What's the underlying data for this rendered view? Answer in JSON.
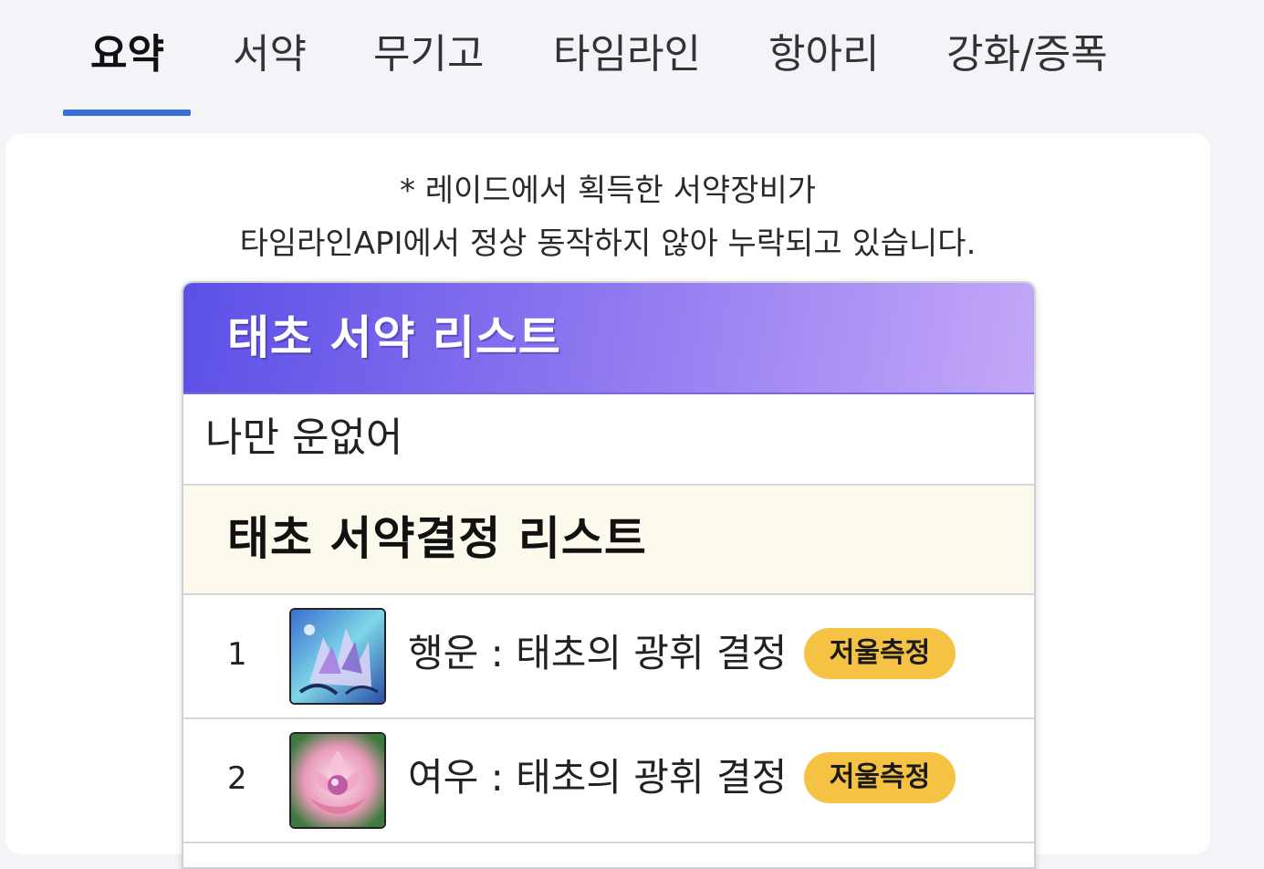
{
  "tabs": [
    {
      "label": "요약",
      "active": true
    },
    {
      "label": "서약",
      "active": false
    },
    {
      "label": "무기고",
      "active": false
    },
    {
      "label": "타임라인",
      "active": false
    },
    {
      "label": "항아리",
      "active": false
    },
    {
      "label": "강화/증폭",
      "active": false
    }
  ],
  "notice": {
    "line1": "* 레이드에서 획득한 서약장비가",
    "line2": "타임라인API에서 정상 동작하지 않아 누락되고 있습니다."
  },
  "pledge_list": {
    "title": "태초 서약 리스트",
    "empty_text": "나만 운없어"
  },
  "crystal_list": {
    "title": "태초 서약결정 리스트",
    "items": [
      {
        "rank": "1",
        "name": "행운 : 태초의 광휘 결정",
        "badge": "저울측정",
        "icon": "luck-crystal-icon"
      },
      {
        "rank": "2",
        "name": "여우 : 태초의 광휘 결정",
        "badge": "저울측정",
        "icon": "fox-crystal-icon"
      }
    ]
  },
  "colors": {
    "accent": "#3b6fd8",
    "header_gradient_start": "#5b50e6",
    "header_gradient_end": "#c3a8f8",
    "badge": "#f5c243",
    "subheader_bg": "#fdf9ec"
  }
}
